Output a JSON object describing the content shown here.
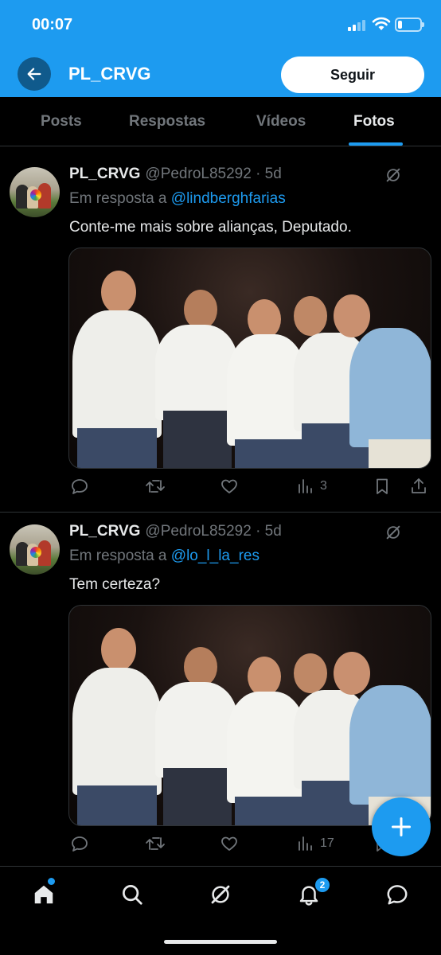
{
  "status_bar": {
    "time": "00:07"
  },
  "header": {
    "title": "PL_CRVG",
    "follow_label": "Seguir"
  },
  "tabs": [
    {
      "label": "Posts",
      "active": false
    },
    {
      "label": "Respostas",
      "active": false
    },
    {
      "label": "Vídeos",
      "active": false
    },
    {
      "label": "Fotos",
      "active": true
    }
  ],
  "posts": [
    {
      "name": "PL_CRVG",
      "handle": "@PedroL85292 · 5d",
      "reply_prefix": "Em resposta a",
      "reply_to": "@lindberghfarias",
      "text": "Conte-me mais sobre alianças, Deputado.",
      "views": "3"
    },
    {
      "name": "PL_CRVG",
      "handle": "@PedroL85292 · 5d",
      "reply_prefix": "Em resposta a",
      "reply_to": "@lo_l_la_res",
      "text": "Tem certeza?",
      "views": "17"
    }
  ],
  "bottom_nav": {
    "notifications_count": "2"
  },
  "colors": {
    "accent": "#1d9bf0",
    "background": "#000000",
    "muted": "#71767b"
  }
}
